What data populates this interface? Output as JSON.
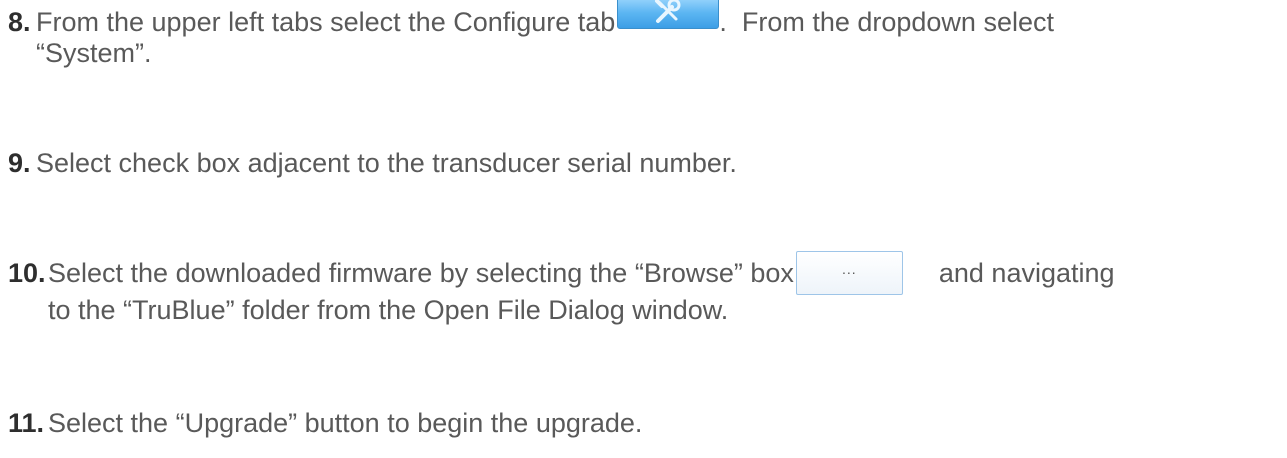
{
  "steps": [
    {
      "number": "8.",
      "text_before_icon": "From the upper left tabs select the Configure tab",
      "text_after_icon": ".  From the dropdown select",
      "text_line2": "“System”.",
      "icon": "configure-tools-icon"
    },
    {
      "number": "9.",
      "text": "Select check box adjacent to the transducer serial number."
    },
    {
      "number": "10.",
      "text_before_button": "Select the downloaded firmware by selecting the “Browse” box",
      "button_label": "...",
      "text_after_button": "and navigating",
      "text_line2": "to the “TruBlue” folder from the Open File Dialog window."
    },
    {
      "number": "11.",
      "text": "Select the “Upgrade” button to begin the upgrade."
    }
  ]
}
